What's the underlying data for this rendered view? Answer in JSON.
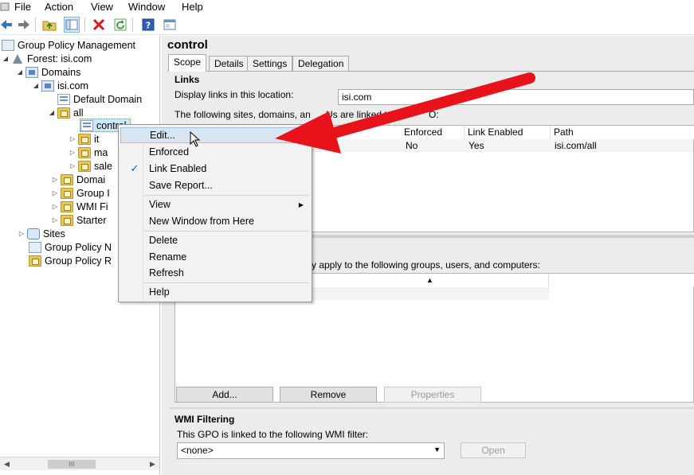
{
  "menu": [
    "File",
    "Action",
    "View",
    "Window",
    "Help"
  ],
  "toolbar": {
    "icons": [
      "back-arrow-icon",
      "forward-arrow-icon",
      "up-folder-icon",
      "show-hide-console-tree-icon",
      "delete-icon",
      "refresh-icon",
      "help-icon",
      "properties-icon"
    ]
  },
  "tree": {
    "root": "Group Policy Management",
    "forest": "Forest: isi.com",
    "domains": "Domains",
    "domain": "isi.com",
    "default_domain": "Default Domain",
    "all": "all",
    "control": "control",
    "it": "it",
    "ma": "ma",
    "sale": "sale",
    "domain_controllers": "Domai",
    "group_policy_objects": "Group I",
    "wmi_filters": "WMI Fi",
    "starter": "Starter",
    "sites": "Sites",
    "group_policy_modeling": "Group Policy N",
    "group_policy_results": "Group Policy R",
    "scroll_thumb": "III"
  },
  "right": {
    "title": "control",
    "tabs": [
      "Scope",
      "Details",
      "Settings",
      "Delegation"
    ],
    "links": {
      "header": "Links",
      "display_label": "Display links in this location:",
      "display_value": "isi.com",
      "linked_text_a": "The following sites, domains, an",
      "linked_text_b": "Us are linked to",
      "linked_text_c": "O:",
      "columns": [
        "Enforced",
        "Link Enabled",
        "Path"
      ],
      "row": {
        "enforced": "No",
        "link_enabled": "Yes",
        "path": "isi.com/all"
      }
    },
    "security": {
      "text": "y apply to the following groups, users, and computers:",
      "sort_arrow": "▲"
    },
    "buttons": {
      "add": "Add...",
      "remove": "Remove",
      "properties": "Properties"
    },
    "wmi": {
      "header": "WMI Filtering",
      "text": "This GPO is linked to the following WMI filter:",
      "value": "<none>",
      "open": "Open"
    }
  },
  "context_menu": {
    "items": [
      {
        "label": "Edit...",
        "hover": true
      },
      {
        "label": "Enforced"
      },
      {
        "label": "Link Enabled",
        "checked": true
      },
      {
        "label": "Save Report..."
      },
      {
        "label": "View",
        "submenu": true
      },
      {
        "label": "New Window from Here"
      },
      {
        "label": "Delete"
      },
      {
        "label": "Rename"
      },
      {
        "label": "Refresh"
      },
      {
        "label": "Help"
      }
    ],
    "check_glyph": "✓",
    "submenu_glyph": "▶"
  },
  "colors": {
    "annotation_arrow": "#e8131a",
    "selection": "#cce8ff",
    "menu_hover": "#d8e6f2"
  }
}
